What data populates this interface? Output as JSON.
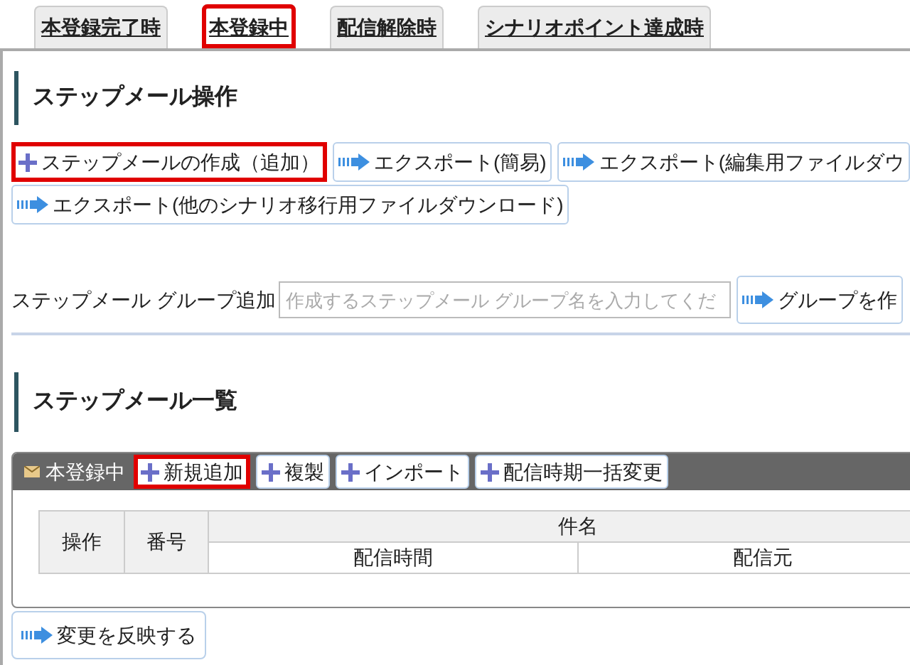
{
  "tabs": [
    {
      "label": "本登録完了時",
      "selected": false,
      "highlighted": false
    },
    {
      "label": "本登録中",
      "selected": true,
      "highlighted": true
    },
    {
      "label": "配信解除時",
      "selected": false,
      "highlighted": false
    },
    {
      "label": "シナリオポイント達成時",
      "selected": false,
      "highlighted": false
    }
  ],
  "operations": {
    "heading": "ステップメール操作",
    "buttons": [
      {
        "label": "ステップメールの作成（追加）",
        "kind": "add",
        "highlighted": true
      },
      {
        "label": "エクスポート(簡易)",
        "kind": "go",
        "highlighted": false
      },
      {
        "label": "エクスポート(編集用ファイルダウ",
        "kind": "go",
        "highlighted": false
      },
      {
        "label": "エクスポート(他のシナリオ移行用ファイルダウンロード)",
        "kind": "go",
        "highlighted": false
      }
    ]
  },
  "group_add": {
    "label": "ステップメール グループ追加",
    "placeholder": "作成するステップメール グループ名を入力してくだ",
    "button": {
      "label": "グループを作",
      "kind": "go"
    }
  },
  "list": {
    "heading": "ステップメール一覧",
    "panel_title": "本登録中",
    "buttons": [
      {
        "label": "新規追加",
        "kind": "add",
        "highlighted": true
      },
      {
        "label": "複製",
        "kind": "add",
        "highlighted": false
      },
      {
        "label": "インポート",
        "kind": "add",
        "highlighted": false
      },
      {
        "label": "配信時期一括変更",
        "kind": "add",
        "highlighted": false
      }
    ],
    "table": {
      "columns": [
        "操作",
        "番号",
        "件名"
      ],
      "subcolumns": [
        "配信時間",
        "配信元"
      ]
    }
  },
  "apply_button": {
    "label": "変更を反映する",
    "kind": "go"
  }
}
